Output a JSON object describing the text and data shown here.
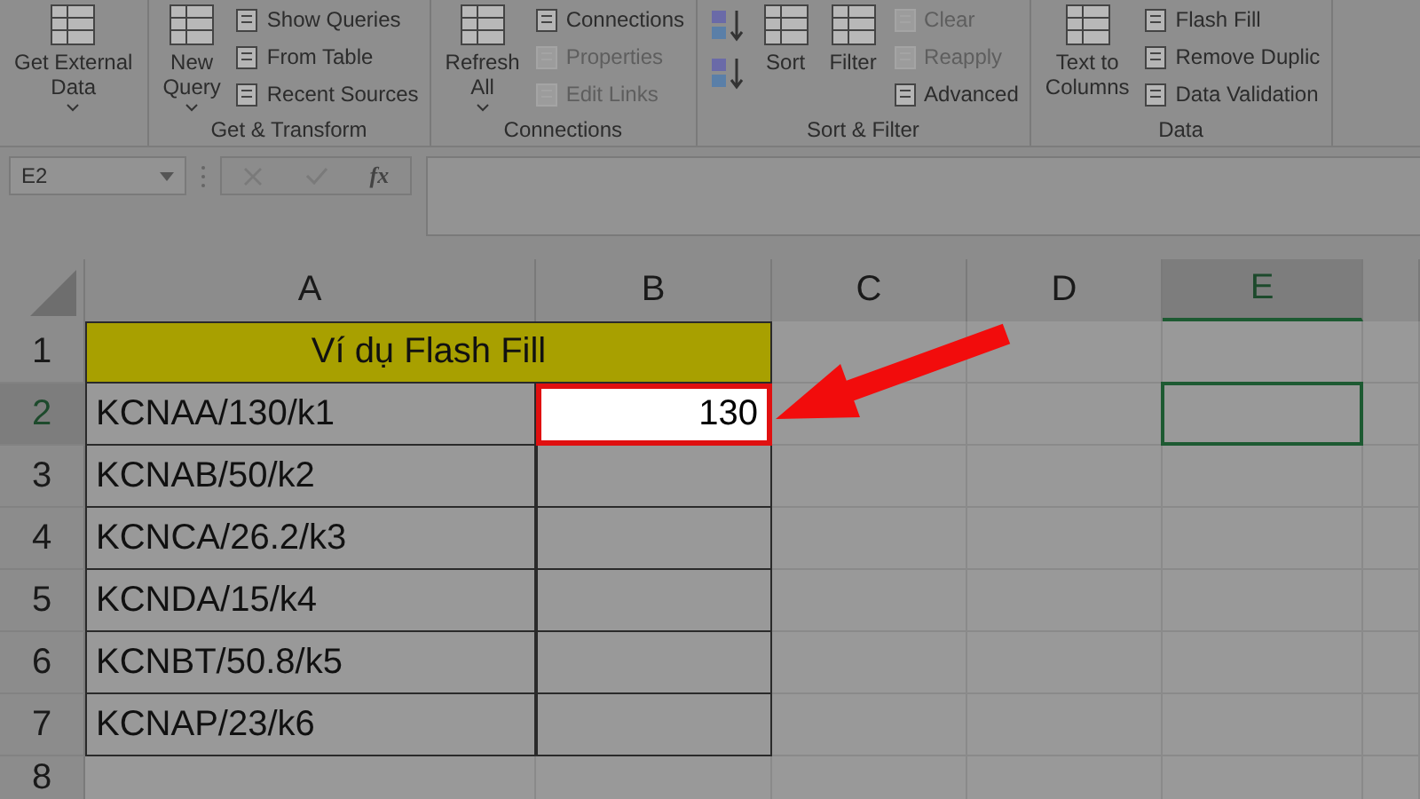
{
  "ribbon": {
    "groups": [
      {
        "columns": [
          [
            {
              "kind": "large",
              "lines": [
                "Get External",
                "Data"
              ],
              "dropdown": true,
              "disabled": false
            }
          ]
        ]
      },
      {
        "label": "Get & Transform",
        "columns": [
          [
            {
              "kind": "large",
              "lines": [
                "New",
                "Query"
              ],
              "dropdown": true,
              "disabled": false
            }
          ],
          [
            {
              "kind": "small",
              "label": "Show Queries",
              "disabled": false
            },
            {
              "kind": "small",
              "label": "From Table",
              "disabled": false
            },
            {
              "kind": "small",
              "label": "Recent Sources",
              "disabled": false
            }
          ]
        ]
      },
      {
        "label": "Connections",
        "columns": [
          [
            {
              "kind": "large",
              "lines": [
                "Refresh",
                "All"
              ],
              "dropdown": true,
              "disabled": false
            }
          ],
          [
            {
              "kind": "small",
              "label": "Connections",
              "disabled": false
            },
            {
              "kind": "small",
              "label": "Properties",
              "disabled": true
            },
            {
              "kind": "small",
              "label": "Edit Links",
              "disabled": true
            }
          ]
        ]
      },
      {
        "label": "Sort & Filter",
        "columns": [
          [
            {
              "kind": "sort",
              "disabled": false
            },
            {
              "kind": "sort",
              "disabled": false
            }
          ],
          [
            {
              "kind": "large",
              "lines": [
                "Sort"
              ],
              "dropdown": false,
              "disabled": false
            }
          ],
          [
            {
              "kind": "large",
              "lines": [
                "Filter"
              ],
              "dropdown": false,
              "disabled": false
            }
          ],
          [
            {
              "kind": "small",
              "label": "Clear",
              "disabled": true
            },
            {
              "kind": "small",
              "label": "Reapply",
              "disabled": true
            },
            {
              "kind": "small",
              "label": "Advanced",
              "disabled": false
            }
          ]
        ]
      },
      {
        "label": "Data",
        "columns": [
          [
            {
              "kind": "large",
              "lines": [
                "Text to",
                "Columns"
              ],
              "dropdown": false,
              "disabled": false
            }
          ],
          [
            {
              "kind": "small",
              "label": "Flash Fill",
              "disabled": false
            },
            {
              "kind": "small",
              "label": "Remove Duplic",
              "disabled": false
            },
            {
              "kind": "small",
              "label": "Data Validation",
              "disabled": false
            }
          ]
        ]
      }
    ]
  },
  "formula_bar": {
    "name_box": "E2",
    "function_label": "fx"
  },
  "grid": {
    "columns": [
      {
        "label": "A",
        "selected": false
      },
      {
        "label": "B",
        "selected": false
      },
      {
        "label": "C",
        "selected": false
      },
      {
        "label": "D",
        "selected": false
      },
      {
        "label": "E",
        "selected": true
      }
    ],
    "rows": [
      {
        "header": "1",
        "selected": false,
        "kind": "title",
        "title": "Ví dụ Flash Fill"
      },
      {
        "header": "2",
        "selected": true,
        "kind": "data",
        "a": "KCNAA/130/k1",
        "b": "130",
        "highlighted": true
      },
      {
        "header": "3",
        "selected": false,
        "kind": "data",
        "a": "KCNAB/50/k2",
        "highlighted": false
      },
      {
        "header": "4",
        "selected": false,
        "kind": "data",
        "a": "KCNCA/26.2/k3",
        "highlighted": false
      },
      {
        "header": "5",
        "selected": false,
        "kind": "data",
        "a": "KCNDA/15/k4",
        "highlighted": false
      },
      {
        "header": "6",
        "selected": false,
        "kind": "data",
        "a": "KCNBT/50.8/k5",
        "highlighted": false
      },
      {
        "header": "7",
        "selected": false,
        "kind": "data",
        "a": "KCNAP/23/k6",
        "highlighted": false
      },
      {
        "header": "8",
        "selected": false,
        "kind": "empty"
      }
    ]
  }
}
